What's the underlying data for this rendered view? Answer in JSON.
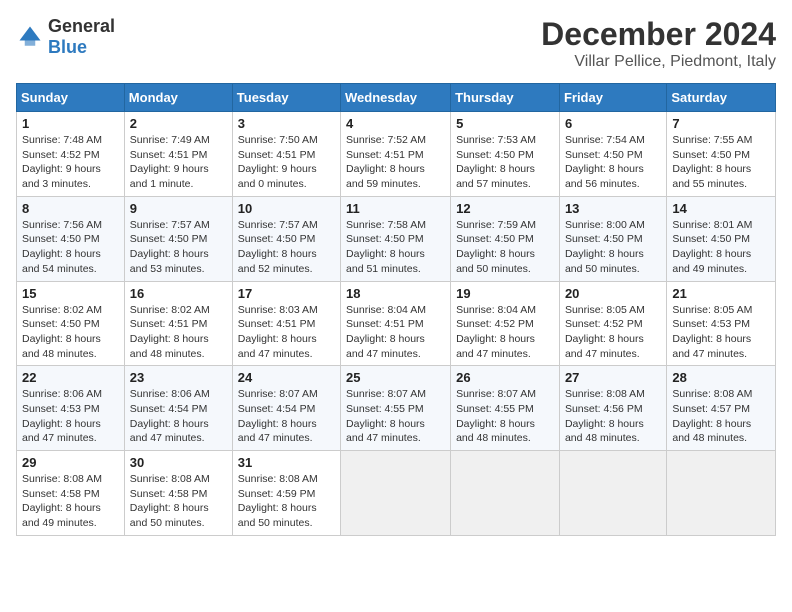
{
  "header": {
    "logo_general": "General",
    "logo_blue": "Blue",
    "month": "December 2024",
    "location": "Villar Pellice, Piedmont, Italy"
  },
  "weekdays": [
    "Sunday",
    "Monday",
    "Tuesday",
    "Wednesday",
    "Thursday",
    "Friday",
    "Saturday"
  ],
  "weeks": [
    [
      {
        "day": "1",
        "info": "Sunrise: 7:48 AM\nSunset: 4:52 PM\nDaylight: 9 hours\nand 3 minutes."
      },
      {
        "day": "2",
        "info": "Sunrise: 7:49 AM\nSunset: 4:51 PM\nDaylight: 9 hours\nand 1 minute."
      },
      {
        "day": "3",
        "info": "Sunrise: 7:50 AM\nSunset: 4:51 PM\nDaylight: 9 hours\nand 0 minutes."
      },
      {
        "day": "4",
        "info": "Sunrise: 7:52 AM\nSunset: 4:51 PM\nDaylight: 8 hours\nand 59 minutes."
      },
      {
        "day": "5",
        "info": "Sunrise: 7:53 AM\nSunset: 4:50 PM\nDaylight: 8 hours\nand 57 minutes."
      },
      {
        "day": "6",
        "info": "Sunrise: 7:54 AM\nSunset: 4:50 PM\nDaylight: 8 hours\nand 56 minutes."
      },
      {
        "day": "7",
        "info": "Sunrise: 7:55 AM\nSunset: 4:50 PM\nDaylight: 8 hours\nand 55 minutes."
      }
    ],
    [
      {
        "day": "8",
        "info": "Sunrise: 7:56 AM\nSunset: 4:50 PM\nDaylight: 8 hours\nand 54 minutes."
      },
      {
        "day": "9",
        "info": "Sunrise: 7:57 AM\nSunset: 4:50 PM\nDaylight: 8 hours\nand 53 minutes."
      },
      {
        "day": "10",
        "info": "Sunrise: 7:57 AM\nSunset: 4:50 PM\nDaylight: 8 hours\nand 52 minutes."
      },
      {
        "day": "11",
        "info": "Sunrise: 7:58 AM\nSunset: 4:50 PM\nDaylight: 8 hours\nand 51 minutes."
      },
      {
        "day": "12",
        "info": "Sunrise: 7:59 AM\nSunset: 4:50 PM\nDaylight: 8 hours\nand 50 minutes."
      },
      {
        "day": "13",
        "info": "Sunrise: 8:00 AM\nSunset: 4:50 PM\nDaylight: 8 hours\nand 50 minutes."
      },
      {
        "day": "14",
        "info": "Sunrise: 8:01 AM\nSunset: 4:50 PM\nDaylight: 8 hours\nand 49 minutes."
      }
    ],
    [
      {
        "day": "15",
        "info": "Sunrise: 8:02 AM\nSunset: 4:50 PM\nDaylight: 8 hours\nand 48 minutes."
      },
      {
        "day": "16",
        "info": "Sunrise: 8:02 AM\nSunset: 4:51 PM\nDaylight: 8 hours\nand 48 minutes."
      },
      {
        "day": "17",
        "info": "Sunrise: 8:03 AM\nSunset: 4:51 PM\nDaylight: 8 hours\nand 47 minutes."
      },
      {
        "day": "18",
        "info": "Sunrise: 8:04 AM\nSunset: 4:51 PM\nDaylight: 8 hours\nand 47 minutes."
      },
      {
        "day": "19",
        "info": "Sunrise: 8:04 AM\nSunset: 4:52 PM\nDaylight: 8 hours\nand 47 minutes."
      },
      {
        "day": "20",
        "info": "Sunrise: 8:05 AM\nSunset: 4:52 PM\nDaylight: 8 hours\nand 47 minutes."
      },
      {
        "day": "21",
        "info": "Sunrise: 8:05 AM\nSunset: 4:53 PM\nDaylight: 8 hours\nand 47 minutes."
      }
    ],
    [
      {
        "day": "22",
        "info": "Sunrise: 8:06 AM\nSunset: 4:53 PM\nDaylight: 8 hours\nand 47 minutes."
      },
      {
        "day": "23",
        "info": "Sunrise: 8:06 AM\nSunset: 4:54 PM\nDaylight: 8 hours\nand 47 minutes."
      },
      {
        "day": "24",
        "info": "Sunrise: 8:07 AM\nSunset: 4:54 PM\nDaylight: 8 hours\nand 47 minutes."
      },
      {
        "day": "25",
        "info": "Sunrise: 8:07 AM\nSunset: 4:55 PM\nDaylight: 8 hours\nand 47 minutes."
      },
      {
        "day": "26",
        "info": "Sunrise: 8:07 AM\nSunset: 4:55 PM\nDaylight: 8 hours\nand 48 minutes."
      },
      {
        "day": "27",
        "info": "Sunrise: 8:08 AM\nSunset: 4:56 PM\nDaylight: 8 hours\nand 48 minutes."
      },
      {
        "day": "28",
        "info": "Sunrise: 8:08 AM\nSunset: 4:57 PM\nDaylight: 8 hours\nand 48 minutes."
      }
    ],
    [
      {
        "day": "29",
        "info": "Sunrise: 8:08 AM\nSunset: 4:58 PM\nDaylight: 8 hours\nand 49 minutes."
      },
      {
        "day": "30",
        "info": "Sunrise: 8:08 AM\nSunset: 4:58 PM\nDaylight: 8 hours\nand 50 minutes."
      },
      {
        "day": "31",
        "info": "Sunrise: 8:08 AM\nSunset: 4:59 PM\nDaylight: 8 hours\nand 50 minutes."
      },
      null,
      null,
      null,
      null
    ]
  ]
}
